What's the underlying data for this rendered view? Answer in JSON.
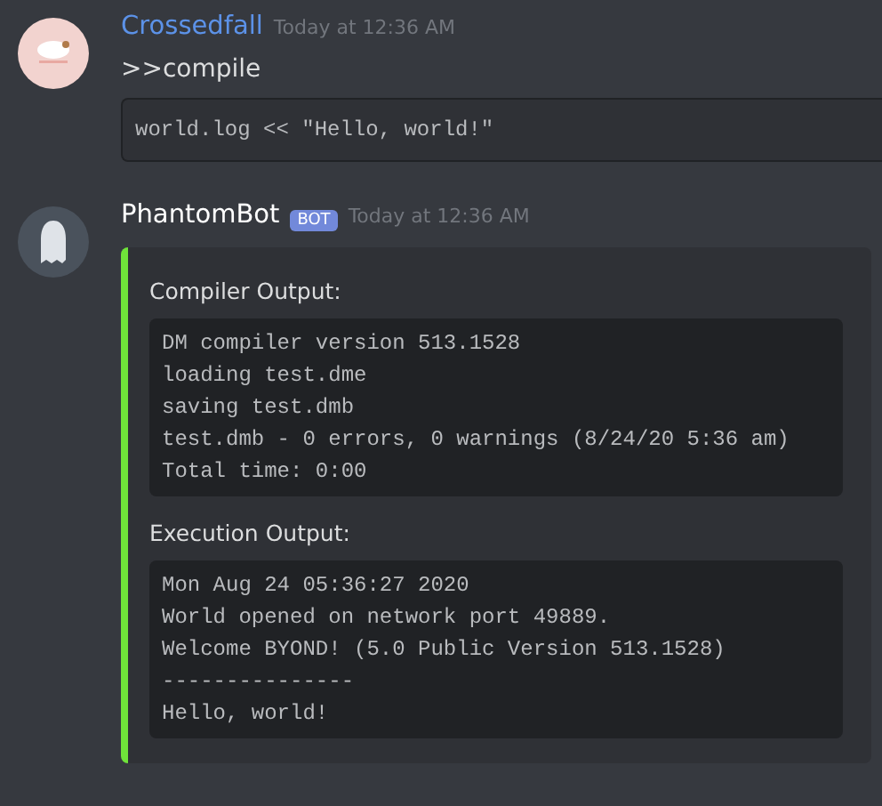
{
  "messages": [
    {
      "kind": "user",
      "author": "Crossedfall",
      "timestamp": "Today at 12:36 AM",
      "content": ">>compile",
      "code": "world.log << \"Hello, world!\""
    },
    {
      "kind": "bot",
      "author": "PhantomBot",
      "bot_badge": "BOT",
      "timestamp": "Today at 12:36 AM",
      "embed": {
        "fields": [
          {
            "name": "Compiler Output:",
            "code": "DM compiler version 513.1528\nloading test.dme\nsaving test.dmb\ntest.dmb - 0 errors, 0 warnings (8/24/20 5:36 am)\nTotal time: 0:00"
          },
          {
            "name": "Execution Output:",
            "code": "Mon Aug 24 05:36:27 2020\nWorld opened on network port 49889.\nWelcome BYOND! (5.0 Public Version 513.1528)\n---------------\nHello, world!"
          }
        ]
      }
    }
  ]
}
